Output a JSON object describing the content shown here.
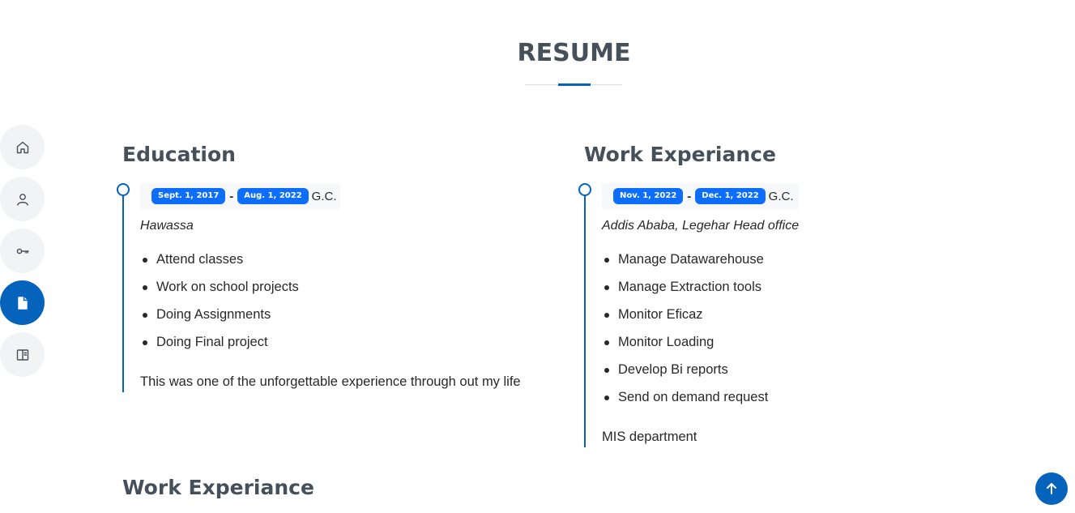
{
  "section": {
    "title": "RESUME"
  },
  "nav": {
    "items": [
      {
        "icon": "home-icon"
      },
      {
        "icon": "person-icon"
      },
      {
        "icon": "key-icon"
      },
      {
        "icon": "file-icon",
        "active": true
      },
      {
        "icon": "book-icon"
      }
    ]
  },
  "education": {
    "title": "Education",
    "start_date": "Sept. 1, 2017",
    "end_date": "Aug. 1, 2022",
    "dash": "-",
    "calendar": "G.C.",
    "place": "Hawassa",
    "items": [
      "Attend classes",
      "Work on school projects",
      "Doing Assignments",
      "Doing Final project"
    ],
    "summary": "This was one of the unforgettable experience through out my life"
  },
  "work": {
    "title": "Work Experiance",
    "start_date": "Nov. 1, 2022",
    "end_date": "Dec. 1, 2022",
    "dash": "-",
    "calendar": "G.C.",
    "place": "Addis Ababa, Legehar Head office",
    "items": [
      "Manage Datawarehouse",
      "Manage Extraction tools",
      "Monitor Eficaz",
      "Monitor Loading",
      "Develop Bi reports",
      "Send on demand request"
    ],
    "summary": "MIS department"
  },
  "work2": {
    "title": "Work Experiance"
  },
  "colors": {
    "accent": "#0563bb",
    "badge": "#0d6efd",
    "heading": "#45505b",
    "text": "#272829"
  }
}
